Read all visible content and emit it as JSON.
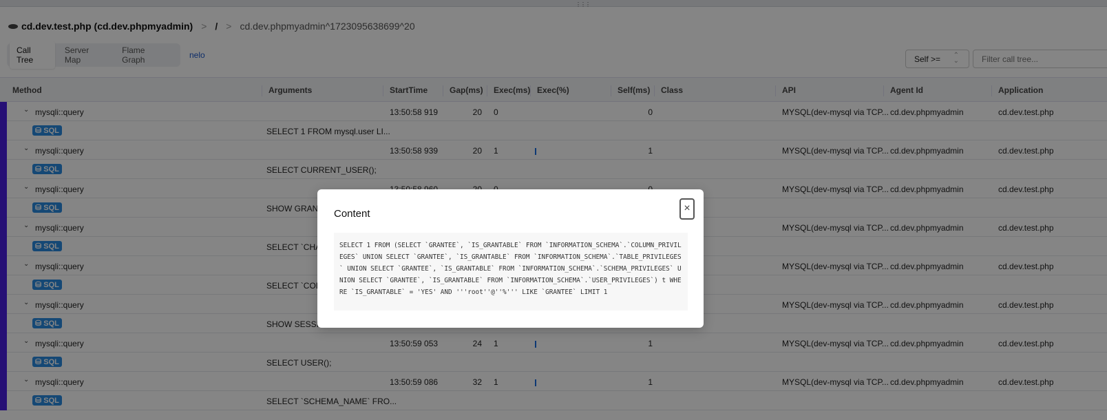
{
  "breadcrumb": {
    "app": "cd.dev.test.php (cd.dev.phpmyadmin)",
    "root": "/",
    "transaction": "cd.dev.phpmyadmin^1723095638699^20"
  },
  "tabs": [
    {
      "label": "Call Tree",
      "active": true
    },
    {
      "label": "Server Map"
    },
    {
      "label": "Flame Graph"
    }
  ],
  "link": "nelo",
  "self_select": "Self >=",
  "filter_placeholder": "Filter call tree...",
  "columns": [
    "Method",
    "Arguments",
    "StartTime",
    "Gap(ms)",
    "Exec(ms)",
    "Exec(%)",
    "Self(ms)",
    "Class",
    "API",
    "Agent Id",
    "Application"
  ],
  "rows": [
    {
      "method": "mysqli::query",
      "start": "13:50:58 919",
      "gap": "20",
      "exec": "0",
      "bar": false,
      "self": "0",
      "api": "MYSQL(dev-mysql via TCP...",
      "agent": "cd.dev.phpmyadmin",
      "app": "cd.dev.test.php",
      "sql": "SELECT 1 FROM mysql.user LI..."
    },
    {
      "method": "mysqli::query",
      "start": "13:50:58 939",
      "gap": "20",
      "exec": "1",
      "bar": true,
      "self": "1",
      "api": "MYSQL(dev-mysql via TCP...",
      "agent": "cd.dev.phpmyadmin",
      "app": "cd.dev.test.php",
      "sql": "SELECT CURRENT_USER();"
    },
    {
      "method": "mysqli::query",
      "start": "13:50:58 960",
      "gap": "20",
      "exec": "0",
      "bar": false,
      "self": "0",
      "api": "MYSQL(dev-mysql via TCP...",
      "agent": "cd.dev.phpmyadmin",
      "app": "cd.dev.test.php",
      "sql": "SHOW GRANT"
    },
    {
      "method": "mysqli::query",
      "api": "MYSQL(dev-mysql via TCP...",
      "agent": "cd.dev.phpmyadmin",
      "app": "cd.dev.test.php",
      "sql": "SELECT `CHAR"
    },
    {
      "method": "mysqli::query",
      "api": "MYSQL(dev-mysql via TCP...",
      "agent": "cd.dev.phpmyadmin",
      "app": "cd.dev.test.php",
      "sql": "SELECT `COLLA"
    },
    {
      "method": "mysqli::query",
      "api": "MYSQL(dev-mysql via TCP...",
      "agent": "cd.dev.phpmyadmin",
      "app": "cd.dev.test.php",
      "sql": "SHOW SESSIO"
    },
    {
      "method": "mysqli::query",
      "start": "13:50:59 053",
      "gap": "24",
      "exec": "1",
      "bar": true,
      "self": "1",
      "api": "MYSQL(dev-mysql via TCP...",
      "agent": "cd.dev.phpmyadmin",
      "app": "cd.dev.test.php",
      "sql": "SELECT USER();"
    },
    {
      "method": "mysqli::query",
      "start": "13:50:59 086",
      "gap": "32",
      "exec": "1",
      "bar": true,
      "self": "1",
      "api": "MYSQL(dev-mysql via TCP...",
      "agent": "cd.dev.phpmyadmin",
      "app": "cd.dev.test.php",
      "sql": "SELECT `SCHEMA_NAME` FRO..."
    }
  ],
  "sql_badge": "SQL",
  "modal": {
    "title": "Content",
    "close": "×",
    "content": "SELECT 1 FROM (SELECT `GRANTEE`, `IS_GRANTABLE` FROM `INFORMATION_SCHEMA`.`COLUMN_PRIVILEGES` UNION SELECT `GRANTEE`, `IS_GRANTABLE` FROM `INFORMATION_SCHEMA`.`TABLE_PRIVILEGES` UNION SELECT `GRANTEE`, `IS_GRANTABLE` FROM `INFORMATION_SCHEMA`.`SCHEMA_PRIVILEGES` UNION SELECT `GRANTEE`, `IS_GRANTABLE` FROM `INFORMATION_SCHEMA`.`USER_PRIVILEGES`) t WHERE `IS_GRANTABLE` = 'YES' AND '''root''@''%''' LIKE `GRANTEE` LIMIT 1"
  },
  "colors": {
    "accent": "#1a56c9",
    "sql_badge": "#2a8ae0",
    "row_marker": "#4a1ee0"
  }
}
